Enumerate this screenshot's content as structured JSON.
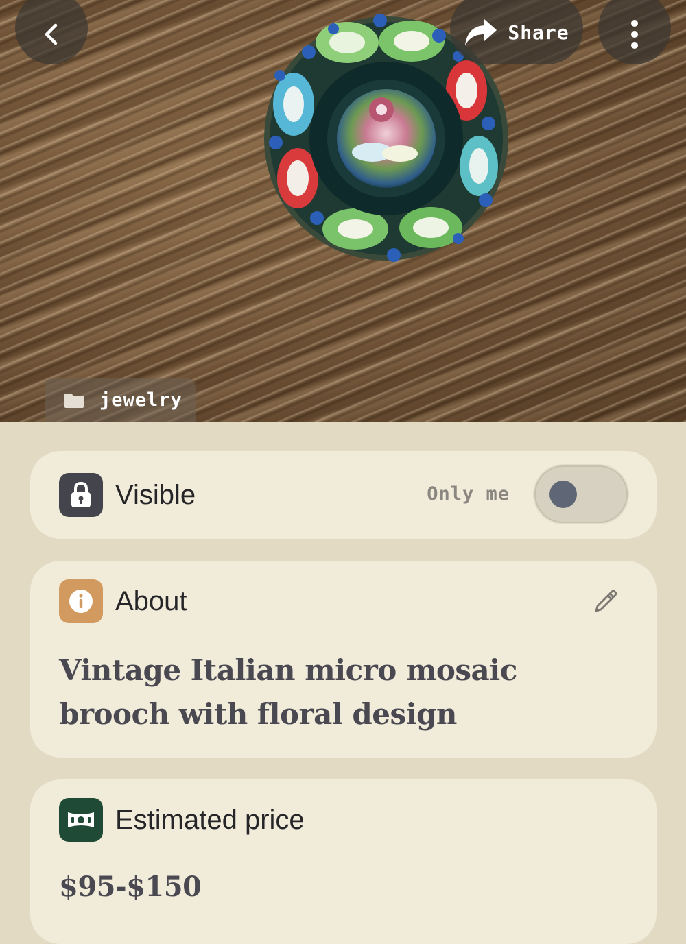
{
  "header": {
    "back_icon": "chevron-left-icon",
    "share_label": "Share",
    "share_icon": "share-arrow-icon",
    "more_icon": "vertical-ellipsis-icon"
  },
  "photo": {
    "subject": "micro mosaic brooch on wooden table",
    "category_label": "jewelry",
    "category_icon": "folder-icon"
  },
  "visibility": {
    "title": "Visible",
    "icon": "lock-icon",
    "status_label": "Only me",
    "toggle_on": false
  },
  "about": {
    "title": "About",
    "icon": "info-icon",
    "edit_icon": "pencil-icon",
    "description": "Vintage Italian micro mosaic brooch with floral design"
  },
  "price": {
    "title": "Estimated price",
    "icon": "banknote-icon",
    "value": "$95-$150"
  },
  "colors": {
    "background": "#e3dac3",
    "card": "#f1ebda",
    "lock_icon_bg": "#44444c",
    "info_icon_bg": "#d29a5e",
    "price_icon_bg": "#1f4a35"
  }
}
